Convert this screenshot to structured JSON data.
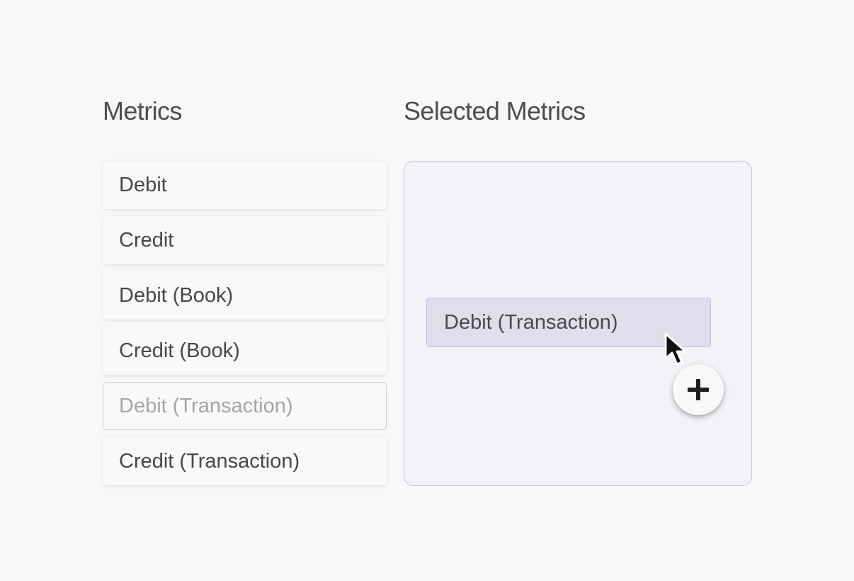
{
  "metrics_panel": {
    "title": "Metrics",
    "items": [
      {
        "label": "Debit"
      },
      {
        "label": "Credit"
      },
      {
        "label": "Debit (Book)"
      },
      {
        "label": "Credit (Book)"
      },
      {
        "label": "Debit (Transaction)"
      },
      {
        "label": "Credit (Transaction)"
      }
    ]
  },
  "selected_panel": {
    "title": "Selected Metrics",
    "dragging_item": {
      "label": "Debit (Transaction)"
    }
  },
  "icons": {
    "cursor": "arrow-cursor-icon",
    "add_badge": "plus-icon"
  },
  "colors": {
    "background": "#f8f8f8",
    "drop_zone_bg": "#f3f2f7",
    "drop_zone_border": "#c6c1e6",
    "drag_chip_bg": "#e1ddec",
    "text": "#474747",
    "muted_text": "#a5a5a5"
  }
}
